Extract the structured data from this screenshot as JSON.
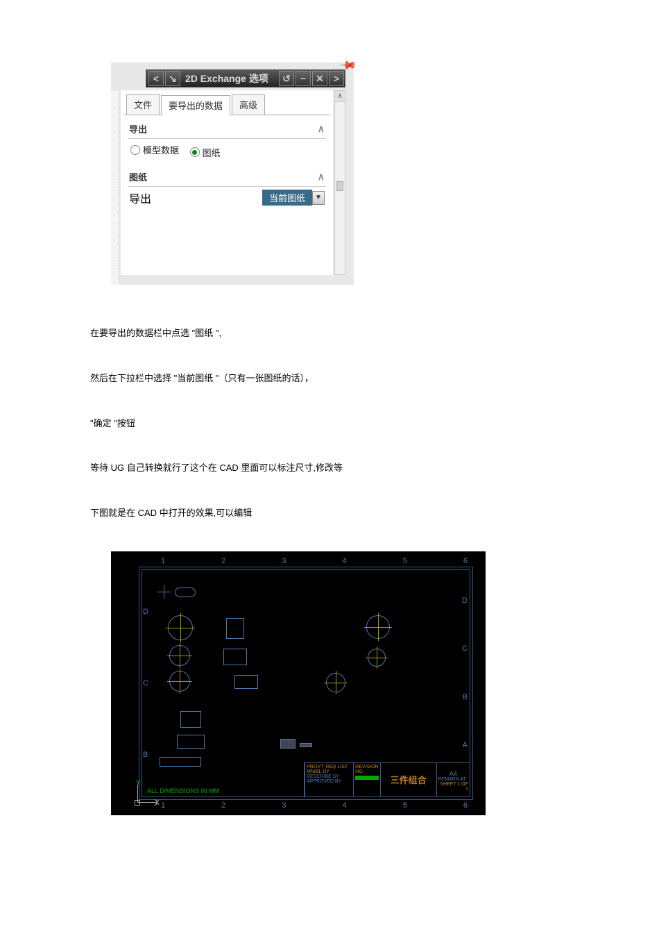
{
  "dialog": {
    "title": "2D Exchange 选项",
    "nav_prev_icon": "chevron-left-icon",
    "nav_next_icon": "chevron-right-icon",
    "pin_icon": "pin-icon",
    "undo_icon": "undo-icon",
    "minimize_icon": "minimize-icon",
    "close_icon": "close-icon",
    "tabs": [
      {
        "label": "文件",
        "active": false
      },
      {
        "label": "要导出的数据",
        "active": true
      },
      {
        "label": "高级",
        "active": false
      }
    ],
    "sections": {
      "export": {
        "title": "导出",
        "radios": [
          {
            "label": "模型数据",
            "selected": false
          },
          {
            "label": "图纸",
            "selected": true
          }
        ]
      },
      "sheet": {
        "title": "图纸",
        "row_label": "导出",
        "dropdown_value": "当前图纸"
      }
    }
  },
  "paragraphs": {
    "p1": "在要导出的数据栏中点选    \"图纸 \",",
    "p2": "然后在下拉栏中选择    \"当前图纸 \"（只有一张图纸的话），",
    "p3": "\"确定 \"按钮",
    "p4": "等待 UG 自己转换就行了这个在   CAD 里面可以标注尺寸,修改等",
    "p5": "下图就是在 CAD 中打开的效果,可以编辑"
  },
  "cad": {
    "columns": [
      "1",
      "2",
      "3",
      "4",
      "5",
      "6"
    ],
    "rows_left": [
      "D",
      "C",
      "B"
    ],
    "rows_right": [
      "D",
      "C",
      "B",
      "A"
    ],
    "all_dimensions": "ALL DIMENSIONS IN MM",
    "title_chinese": "三件组合",
    "paper_size": "A4",
    "ucs": {
      "x": "X",
      "y": "Y"
    },
    "titleblock_hints": [
      "PROV'T REQ LIST",
      "MN/BL DY",
      "DESCRIBE SY",
      "APPROVED BY",
      "REVISION NO.",
      "REMARK AT",
      "SHEET 1 OF 1"
    ]
  }
}
